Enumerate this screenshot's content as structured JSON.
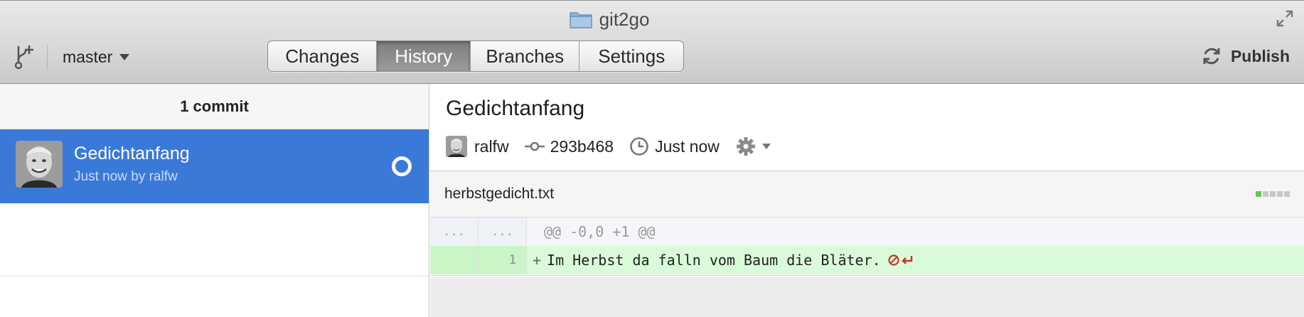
{
  "window": {
    "title": "git2go"
  },
  "toolbar": {
    "branch": "master",
    "tabs": [
      {
        "label": "Changes",
        "active": false
      },
      {
        "label": "History",
        "active": true
      },
      {
        "label": "Branches",
        "active": false
      },
      {
        "label": "Settings",
        "active": false
      }
    ],
    "publish_label": "Publish"
  },
  "history": {
    "count_label": "1 commit",
    "commits": [
      {
        "title": "Gedichtanfang",
        "subtitle": "Just now by ralfw",
        "selected": true
      }
    ]
  },
  "commit": {
    "title": "Gedichtanfang",
    "author": "ralfw",
    "sha": "293b468",
    "time": "Just now"
  },
  "file": {
    "name": "herbstgedicht.txt",
    "diffstat": {
      "additions": 1,
      "deletions": 0
    }
  },
  "diff": {
    "hunk": {
      "old_ln": "...",
      "new_ln": "...",
      "text": "@@ -0,0 +1 @@"
    },
    "lines": [
      {
        "old_ln": "",
        "new_ln": "1",
        "prefix": "+",
        "text": "Im Herbst da falln vom Baum die Bläter.",
        "no_newline": true
      }
    ]
  },
  "colors": {
    "selection": "#3b79d9",
    "added_bg": "#dafbd9",
    "diffstat_add": "#6cc35d",
    "diffstat_neutral": "#c8c8c8",
    "no_newline": "#c0392b"
  }
}
